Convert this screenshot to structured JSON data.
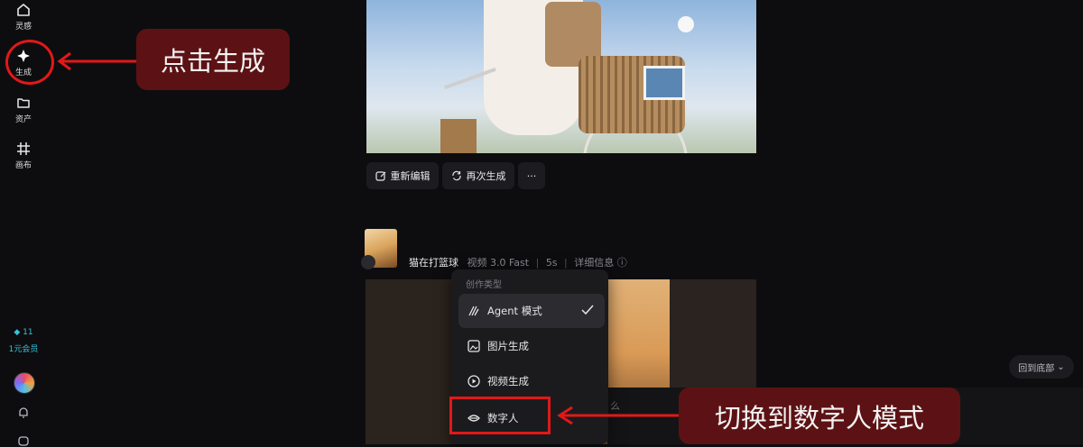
{
  "sidebar": {
    "items": [
      {
        "label": "灵感",
        "icon": "home-icon"
      },
      {
        "label": "生成",
        "icon": "sparkle-icon"
      },
      {
        "label": "资产",
        "icon": "folder-icon"
      },
      {
        "label": "画布",
        "icon": "canvas-grid-icon"
      }
    ],
    "credits": "◆ 11",
    "membership": "1元会员",
    "avatar": "avatar",
    "bell_icon": "bell-icon",
    "chat_icon": "chat-icon"
  },
  "first_result": {
    "image": "girl-on-bicycle-photo",
    "actions": [
      {
        "label": "重新编辑",
        "icon": "edit-icon"
      },
      {
        "label": "再次生成",
        "icon": "regenerate-icon"
      },
      {
        "label": "···",
        "icon": "more-icon"
      }
    ]
  },
  "second_result": {
    "title": "猫在打篮球",
    "model": "视频 3.0 Fast",
    "duration": "5s",
    "details": "详细信息",
    "image": "basketball-court-sunset-video"
  },
  "dropdown": {
    "header": "创作类型",
    "items": [
      {
        "label": "Agent 模式",
        "icon": "agent-icon",
        "selected": true
      },
      {
        "label": "图片生成",
        "icon": "image-icon",
        "selected": false
      },
      {
        "label": "视频生成",
        "icon": "video-icon",
        "selected": false
      },
      {
        "label": "数字人",
        "icon": "lips-icon",
        "selected": false
      }
    ]
  },
  "prompt_hint": "么",
  "scroll_button": "回到底部",
  "annotations": {
    "click_generate": "点击生成",
    "switch_mode": "切换到数字人模式",
    "color": "#e21818"
  }
}
